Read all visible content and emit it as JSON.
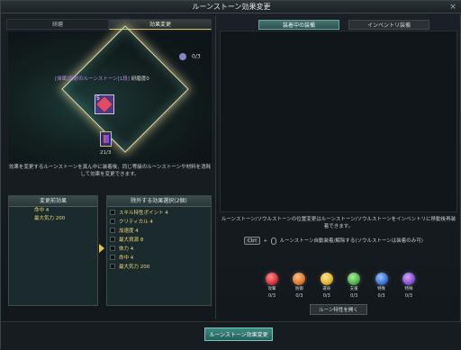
{
  "window": {
    "title": "ルーンストーン効果変更",
    "close_label": "×"
  },
  "left_tabs": [
    "研磨",
    "効果変更"
  ],
  "selected": {
    "counter": "0/3",
    "rune_prefix": "[帰属]",
    "rune_name": "忍耐のルーンストーン[1段]",
    "rune_suffix": "研磨度0",
    "rune_level": "5",
    "stone_count": "21/3"
  },
  "description": "効果を変更するルーンストーンを真ん中に装着後、同じ等級のルーンストーンや材料を消耗して効果を変更できます。",
  "before_panel": {
    "title": "変更前効果",
    "items": [
      "命中 4",
      "最大気力 200"
    ]
  },
  "exclude_panel": {
    "title": "除外する効果選択(2個)",
    "options": [
      "スキル特性ポイント 4",
      "クリティカル 4",
      "加速度 4",
      "最大資源 8",
      "体力 4",
      "命中 4",
      "最大気力 200"
    ]
  },
  "right_tabs": [
    "装着中の装備",
    "インベントリ装備"
  ],
  "info_text": "ルーンストーン/ソウルストーンの位置変更はルーンストーン/ソウルストーンをインベントリに移動後再装着できます。",
  "key_hint": {
    "key": "Ctrl",
    "plus": "+",
    "text": "ルーンストーン自動装着/解除する(ソウルストーンは装着のみ可)"
  },
  "orbs": [
    {
      "name": "攻撃",
      "count": "0/3",
      "color": "#d8323a"
    },
    {
      "name": "防御",
      "count": "0/3",
      "color": "#e0782a"
    },
    {
      "name": "運命",
      "count": "0/3",
      "color": "#e0b22a"
    },
    {
      "name": "支援",
      "count": "0/3",
      "color": "#4fb045"
    },
    {
      "name": "特殊",
      "count": "0/3",
      "color": "#3a72d8"
    },
    {
      "name": "特殊",
      "count": "0/3",
      "color": "#8a4fd0"
    }
  ],
  "open_button": "ルーン特性を開く",
  "main_button": "ルーンストーン効果変更"
}
